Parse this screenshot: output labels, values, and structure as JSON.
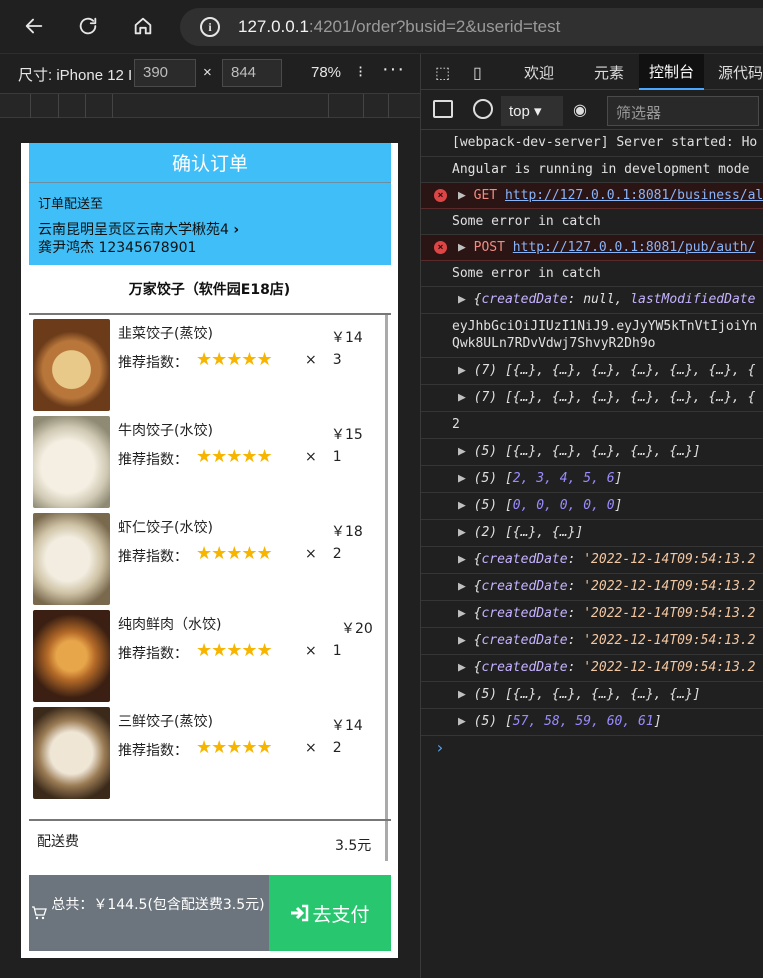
{
  "browser": {
    "url_host": "127.0.0.1",
    "url_rest": ":4201/order?busid=2&userid=test"
  },
  "device_toolbar": {
    "size_label": "尺寸: iPhone 12 I",
    "width": "390",
    "times": "×",
    "height": "844",
    "zoom": "78%"
  },
  "order": {
    "title": "确认订单",
    "ship_to_label": "订单配送至",
    "address": "云南昆明呈贡区云南大学楸苑4",
    "contact": "龚尹鸿杰 12345678901",
    "shop_name": "万家饺子（软件园E18店)",
    "recommend_label": "推荐指数：",
    "stars": "★★★★★",
    "qty_prefix": "×",
    "items": [
      {
        "name": "韭菜饺子(蒸饺)",
        "price": "￥14",
        "qty": "3",
        "rating": 5
      },
      {
        "name": "牛肉饺子(水饺)",
        "price": "￥15",
        "qty": "1",
        "rating": 5
      },
      {
        "name": "虾仁饺子(水饺)",
        "price": "￥18",
        "qty": "2",
        "rating": 5
      },
      {
        "name": "纯肉鲜肉（水饺)",
        "price": "￥20",
        "qty": "1",
        "rating": 5
      },
      {
        "name": "三鲜饺子(蒸饺)",
        "price": "￥14",
        "qty": "2",
        "rating": 5
      }
    ],
    "fee_label": "配送费",
    "fee_value": "3.5元",
    "total_text": "总共：￥144.5(包含配送费3.5元)",
    "pay_label": "去支付"
  },
  "devtools": {
    "tabs": [
      "欢迎",
      "元素",
      "控制台",
      "源代码"
    ],
    "context": "top",
    "filter_placeholder": "筛选器",
    "console": {
      "l1": "[webpack-dev-server] Server started: Ho",
      "l2": "Angular is running in development mode",
      "l3_method": "GET",
      "l3_url": "http://127.0.0.1:8081/business/al",
      "l4": "Some error in catch",
      "l5_method": "POST",
      "l5_url": "http://127.0.0.1:8081/pub/auth/",
      "l6": "Some error in catch",
      "l7_k1": "createdDate",
      "l7_v1": "null",
      "l7_k2": "lastModifiedDate",
      "l8a": "eyJhbGciOiJIUzI1NiJ9.eyJyYW5kTnVtIjoiYn",
      "l8b": "Qwk8ULn7RDvVdwj7ShvyR2Dh9o",
      "l9": "(7) [{…}, {…}, {…}, {…}, {…}, {…}, {",
      "l10": "(7) [{…}, {…}, {…}, {…}, {…}, {…}, {",
      "l11": "2",
      "l12": "(5) [{…}, {…}, {…}, {…}, {…}]",
      "l13_prefix": "(5) [",
      "l13_values": "2, 3, 4, 5, 6",
      "l14_prefix": "(5) [",
      "l14_values": "0, 0, 0, 0, 0",
      "l15": "(2) [{…}, {…}]",
      "created_key": "createdDate",
      "created_val": "'2022-12-14T09:54:13.2",
      "l21": "(5) [{…}, {…}, {…}, {…}, {…}]",
      "l22_prefix": "(5) [",
      "l22_values": "57, 58, 59, 60, 61",
      "prompt": "›"
    }
  }
}
